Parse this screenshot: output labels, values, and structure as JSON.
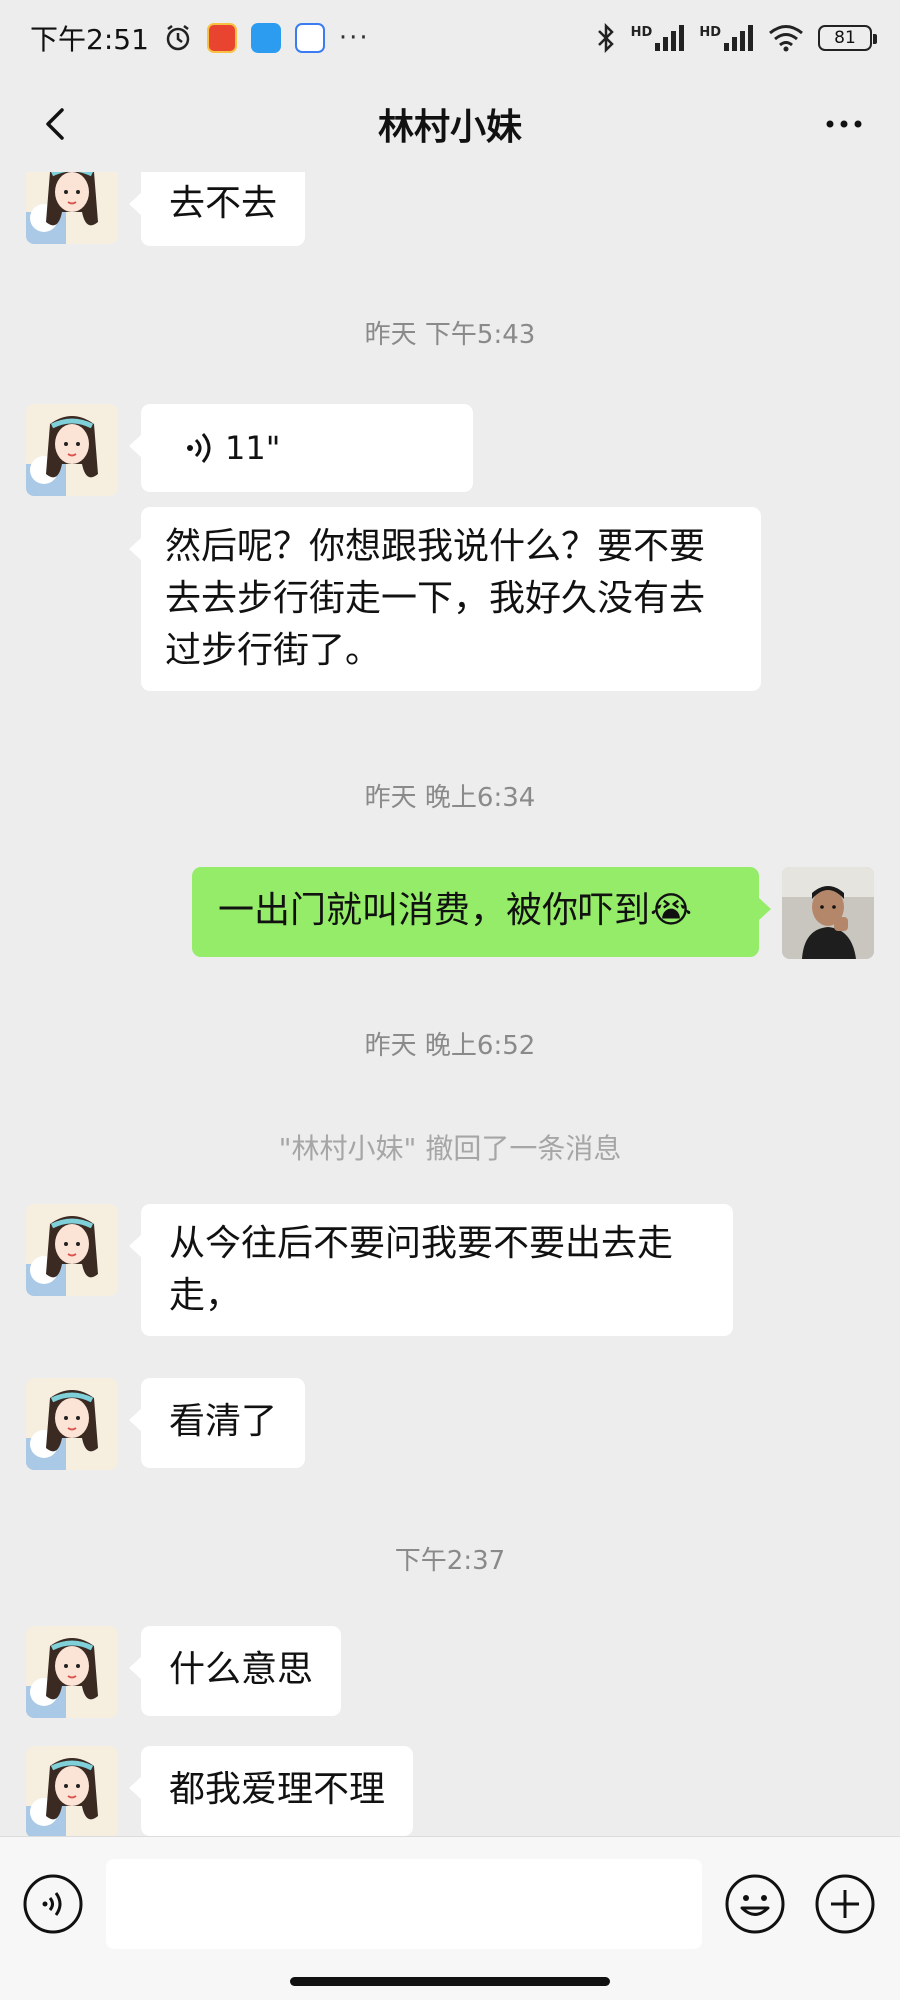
{
  "status_bar": {
    "time": "下午2:51",
    "signal1": "HD",
    "signal2": "HD",
    "battery": "81",
    "more": "···"
  },
  "header": {
    "title": "林村小妹"
  },
  "messages": {
    "m1_text": "去不去",
    "ts1": "昨天 下午5:43",
    "voice_duration": "11\"",
    "m3_text": "然后呢？你想跟我说什么？要不要去去步行街走一下，我好久没有去过步行街了。",
    "ts2": "昨天 晚上6:34",
    "m4_text": "一出门就叫消费，被你吓到😭",
    "ts3": "昨天 晚上6:52",
    "recall": "\"林村小妹\" 撤回了一条消息",
    "m5_text": "从今往后不要问我要不要出去走走，",
    "m6_text": "看清了",
    "ts4": "下午2:37",
    "m7_text": "什么意思",
    "m8_text": "都我爱理不理"
  },
  "input_bar": {
    "value": "",
    "placeholder": ""
  },
  "colors": {
    "background": "#ededed",
    "bubble_self": "#95ec69",
    "bubble_other": "#ffffff"
  }
}
